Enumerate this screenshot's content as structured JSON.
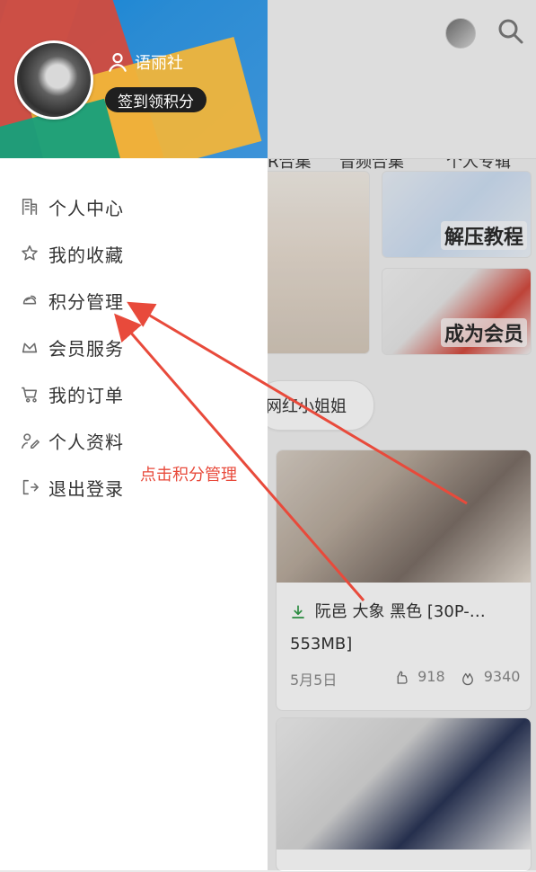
{
  "drawer": {
    "user_name": "语丽社",
    "checkin_label": "签到领积分",
    "menu": [
      {
        "label": "个人中心",
        "icon": "building-icon"
      },
      {
        "label": "我的收藏",
        "icon": "star-icon"
      },
      {
        "label": "积分管理",
        "icon": "coins-icon"
      },
      {
        "label": "会员服务",
        "icon": "crown-icon"
      },
      {
        "label": "我的订单",
        "icon": "cart-icon"
      },
      {
        "label": "个人资料",
        "icon": "user-edit-icon"
      },
      {
        "label": "退出登录",
        "icon": "logout-icon"
      }
    ]
  },
  "background": {
    "tabs": [
      "R合集",
      "音频合集",
      "个人专辑"
    ],
    "cards": {
      "small_top_caption": "解压教程",
      "small_bottom_caption": "成为会员"
    },
    "pill_label": "网红小姐姐",
    "post": {
      "title": "阮邑 大象 黑色 [30P-…",
      "subtitle": "553MB]",
      "date": "5月5日",
      "likes": "918",
      "views": "9340"
    }
  },
  "annotation": {
    "text": "点击积分管理",
    "color": "#e84a3b"
  }
}
